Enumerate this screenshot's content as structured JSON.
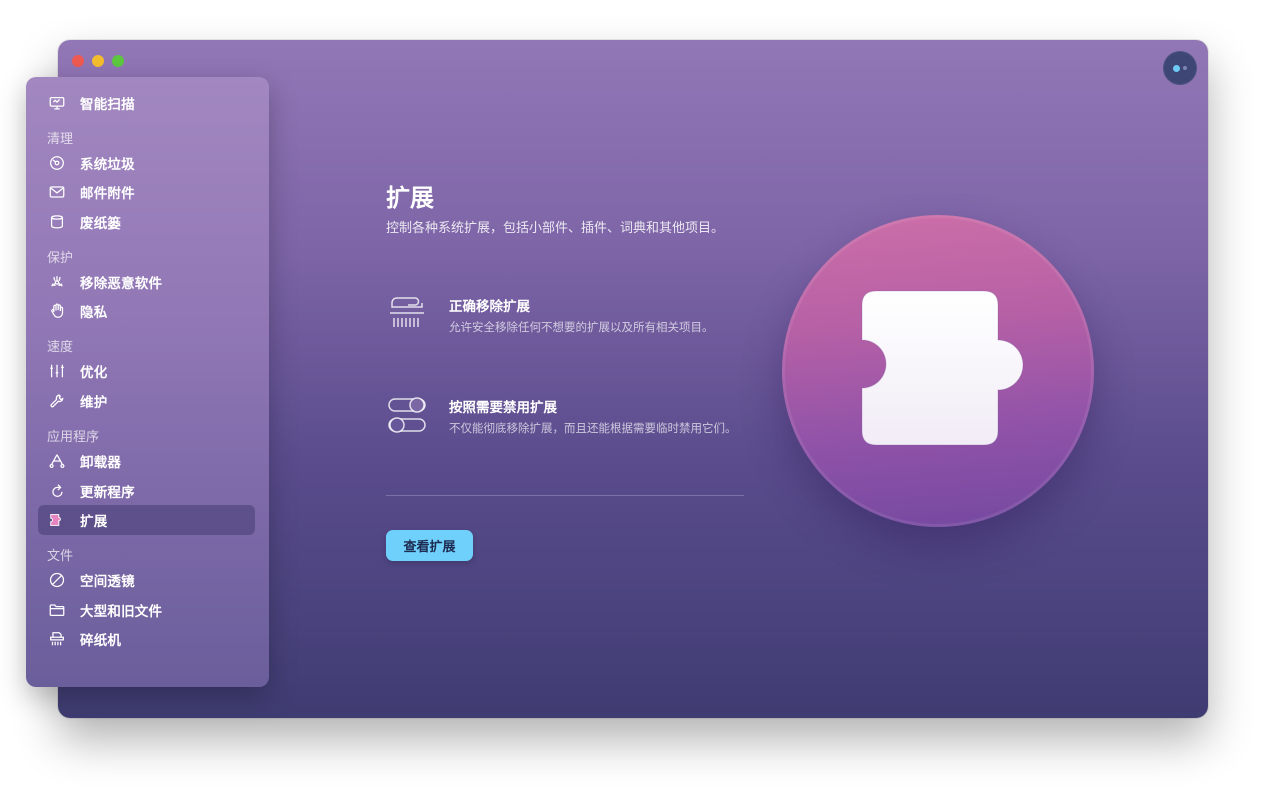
{
  "sidebar": {
    "items": [
      {
        "key": "smart-scan",
        "label": "智能扫描",
        "icon": "monitor-scan-icon"
      },
      {
        "key": "system-junk",
        "label": "系统垃圾",
        "icon": "disk-icon"
      },
      {
        "key": "mail-attachments",
        "label": "邮件附件",
        "icon": "envelope-icon"
      },
      {
        "key": "trash-bins",
        "label": "废纸篓",
        "icon": "trash-bin-icon"
      },
      {
        "key": "malware-removal",
        "label": "移除恶意软件",
        "icon": "biohazard-icon"
      },
      {
        "key": "privacy",
        "label": "隐私",
        "icon": "hand-icon"
      },
      {
        "key": "optimization",
        "label": "优化",
        "icon": "sliders-icon"
      },
      {
        "key": "maintenance",
        "label": "维护",
        "icon": "wrench-icon"
      },
      {
        "key": "uninstaller",
        "label": "卸载器",
        "icon": "uninstaller-icon"
      },
      {
        "key": "updater",
        "label": "更新程序",
        "icon": "update-arrow-icon"
      },
      {
        "key": "extensions",
        "label": "扩展",
        "icon": "puzzle-icon",
        "active": true
      },
      {
        "key": "space-lens",
        "label": "空间透镜",
        "icon": "lens-icon"
      },
      {
        "key": "large-old-files",
        "label": "大型和旧文件",
        "icon": "folder-icon"
      },
      {
        "key": "shredder",
        "label": "碎纸机",
        "icon": "shredder-icon"
      }
    ],
    "sections": {
      "cleanup": "清理",
      "protection": "保护",
      "speed": "速度",
      "applications": "应用程序",
      "files": "文件"
    }
  },
  "main": {
    "title": "扩展",
    "description": "控制各种系统扩展，包括小部件、插件、词典和其他项目。",
    "features": [
      {
        "title": "正确移除扩展",
        "description": "允许安全移除任何不想要的扩展以及所有相关项目。",
        "icon": "shredder-icon"
      },
      {
        "title": "按照需要禁用扩展",
        "description": "不仅能彻底移除扩展，而且还能根据需要临时禁用它们。",
        "icon": "toggles-icon"
      }
    ],
    "cta_label": "查看扩展"
  },
  "colors": {
    "accent": "#6fd0fb",
    "window_top": "#9277b6",
    "window_bottom": "#3f3c72",
    "hero_top": "#cd6fa8",
    "hero_bottom": "#7448a0"
  }
}
